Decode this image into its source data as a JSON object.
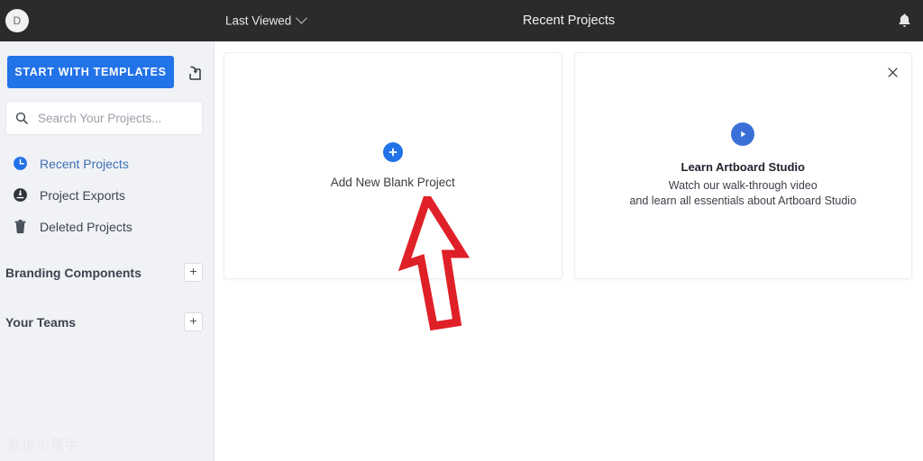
{
  "topbar": {
    "avatar_initial": "D",
    "sort_label": "Last Viewed",
    "sort_chevron_icon": "chevron-down-icon",
    "page_title": "Recent Projects",
    "bell_icon": "bell-icon"
  },
  "sidebar": {
    "templates_button_label": "START WITH TEMPLATES",
    "import_icon": "import-project-icon",
    "search": {
      "icon": "search-icon",
      "placeholder": "Search Your Projects...",
      "value": ""
    },
    "nav_items": [
      {
        "label": "Recent Projects",
        "icon": "clock-icon",
        "active": true
      },
      {
        "label": "Project Exports",
        "icon": "download-circle-icon",
        "active": false
      },
      {
        "label": "Deleted Projects",
        "icon": "trash-icon",
        "active": false
      }
    ],
    "sections": [
      {
        "label": "Branding Components",
        "add_label": "+"
      },
      {
        "label": "Your Teams",
        "add_label": "+"
      }
    ],
    "watermark": "數位小幫手"
  },
  "content": {
    "new_project_card": {
      "plus_icon": "plus-icon",
      "label": "Add New Blank Project"
    },
    "video_card": {
      "play_icon": "play-icon",
      "title": "Learn Artboard Studio",
      "description_line1": "Watch our walk-through video",
      "description_line2": "and learn all essentials about Artboard Studio",
      "close_icon": "close-icon",
      "close_label": "×"
    }
  },
  "annotation": {
    "arrow_icon": "red-arrow-up-icon",
    "color": "#e02028"
  },
  "colors": {
    "accent_blue": "#2272e8",
    "topbar_dark": "#2b2b2b",
    "sidebar_bg": "#f1f2f6",
    "annotation_red": "#e02028"
  }
}
